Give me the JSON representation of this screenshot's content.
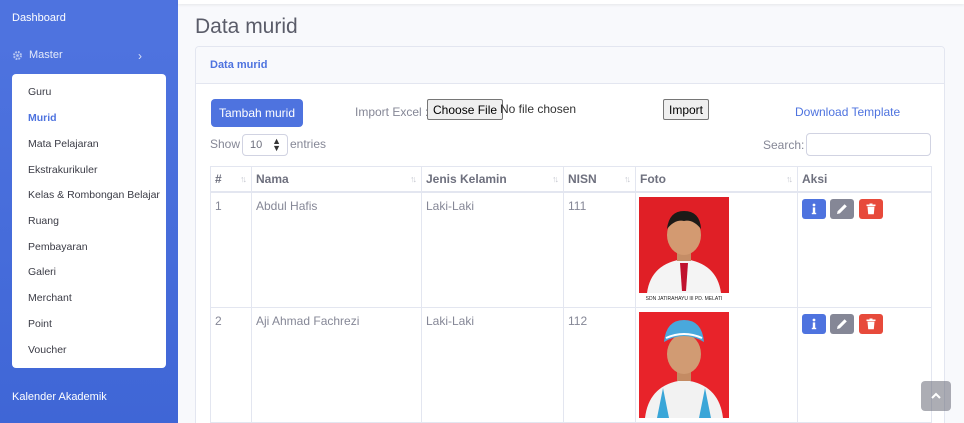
{
  "sidebar": {
    "dashboard": "Dashboard",
    "master": "Master",
    "master_items": [
      {
        "label": "Guru",
        "active": false
      },
      {
        "label": "Murid",
        "active": true
      },
      {
        "label": "Mata Pelajaran",
        "active": false
      },
      {
        "label": "Ekstrakurikuler",
        "active": false
      },
      {
        "label": "Kelas & Rombongan Belajar",
        "active": false
      },
      {
        "label": "Ruang",
        "active": false
      },
      {
        "label": "Pembayaran",
        "active": false
      },
      {
        "label": "Galeri",
        "active": false
      },
      {
        "label": "Merchant",
        "active": false
      },
      {
        "label": "Point",
        "active": false
      },
      {
        "label": "Voucher",
        "active": false
      }
    ],
    "kalender": "Kalender Akademik"
  },
  "page": {
    "title": "Data murid"
  },
  "card": {
    "header": "Data murid",
    "add_button": "Tambah murid",
    "import_label": "Import Excel :",
    "choose_file": "Choose File",
    "no_file": "No file chosen",
    "import_button": "Import",
    "download_template": "Download Template",
    "show_label": "Show",
    "entries_value": "10",
    "entries_label": "entries",
    "search_label": "Search:"
  },
  "table": {
    "headers": [
      "#",
      "Nama",
      "Jenis Kelamin",
      "NISN",
      "Foto",
      "Aksi"
    ],
    "rows": [
      {
        "no": "1",
        "nama": "Abdul Hafis",
        "jk": "Laki-Laki",
        "nisn": "111",
        "photo_caption": "SDN JATIRAHAYU III PD. MELATI"
      },
      {
        "no": "2",
        "nama": "Aji Ahmad Fachrezi",
        "jk": "Laki-Laki",
        "nisn": "112",
        "photo_caption": ""
      }
    ]
  },
  "colors": {
    "primary": "#4e73df",
    "danger": "#e74a3b",
    "secondary": "#858796"
  },
  "icons": {
    "info": "info-icon",
    "edit": "pencil-icon",
    "delete": "trash-icon",
    "settings": "gear-icon",
    "scroll_top": "chevron-up-icon"
  }
}
